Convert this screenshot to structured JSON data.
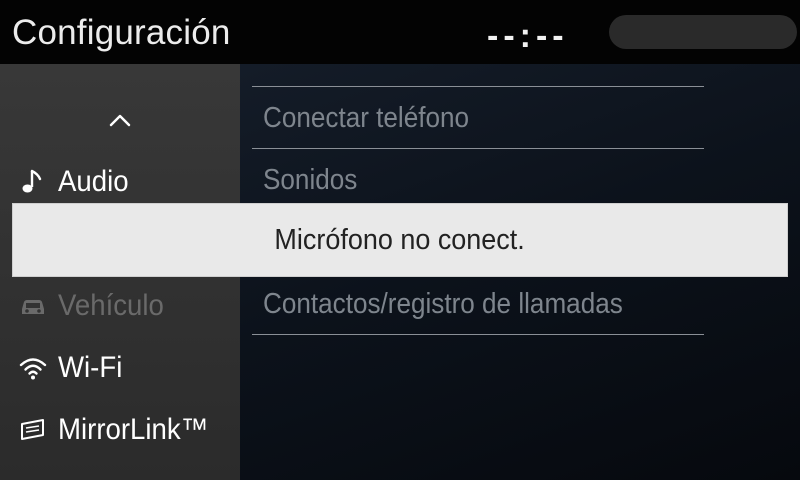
{
  "header": {
    "title": "Configuración",
    "clock": "--:--"
  },
  "sidebar": {
    "items": [
      {
        "label": "Audio",
        "icon": "music-note-icon",
        "enabled": true
      },
      {
        "label": "Vehículo",
        "icon": "car-icon",
        "enabled": false
      },
      {
        "label": "Wi-Fi",
        "icon": "wifi-icon",
        "enabled": true
      },
      {
        "label": "MirrorLink™",
        "icon": "mirrorlink-icon",
        "enabled": true
      }
    ]
  },
  "menu": {
    "items": [
      {
        "label": "Conectar teléfono"
      },
      {
        "label": "Sonidos"
      },
      {
        "label": "Contactos/registro de llamadas"
      }
    ]
  },
  "popup": {
    "message": "Micrófono no conect."
  },
  "colors": {
    "header_bg": "#030303",
    "sidebar_bg": "#333333",
    "content_bg": "#0f1620",
    "popup_bg": "#e9e9e9",
    "menu_text": "#7e858d"
  }
}
